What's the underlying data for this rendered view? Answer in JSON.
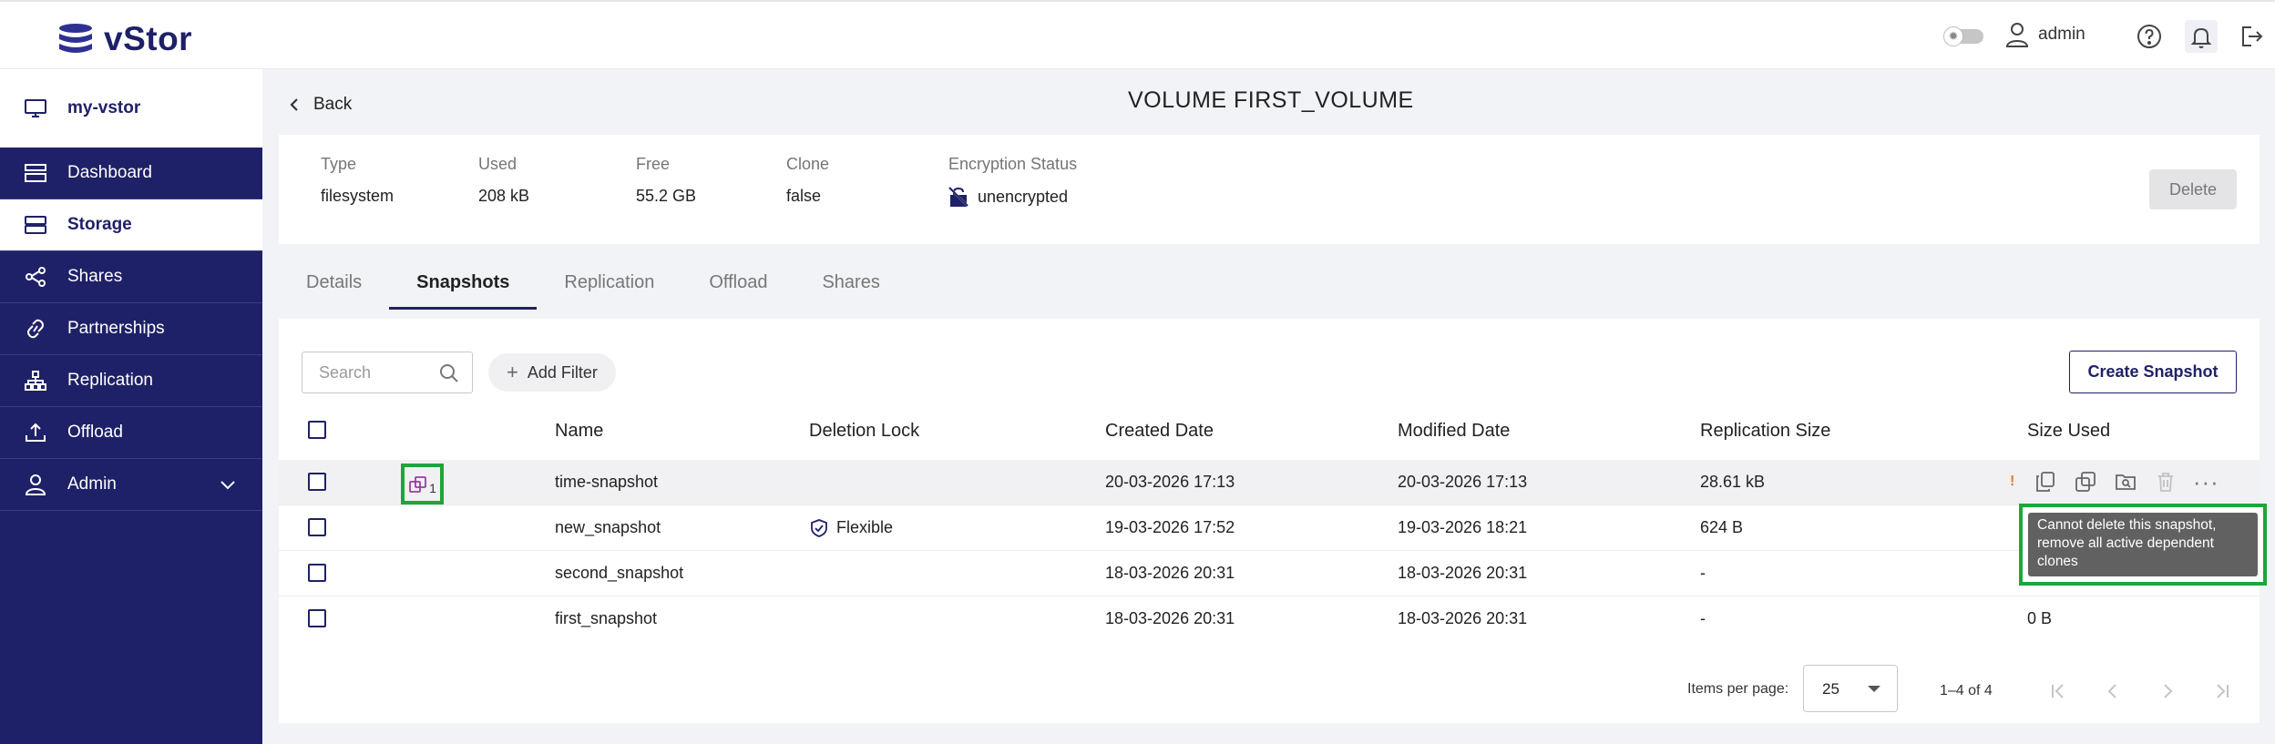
{
  "app": {
    "name": "vStor"
  },
  "header": {
    "user_label": "admin"
  },
  "sidebar": {
    "system_name": "my-vstor",
    "items": [
      {
        "label": "Dashboard"
      },
      {
        "label": "Storage"
      },
      {
        "label": "Shares"
      },
      {
        "label": "Partnerships"
      },
      {
        "label": "Replication"
      },
      {
        "label": "Offload"
      },
      {
        "label": "Admin"
      }
    ]
  },
  "page": {
    "back_label": "Back",
    "title": "VOLUME FIRST_VOLUME"
  },
  "info": {
    "type": {
      "label": "Type",
      "value": "filesystem"
    },
    "used": {
      "label": "Used",
      "value": "208 kB"
    },
    "free": {
      "label": "Free",
      "value": "55.2 GB"
    },
    "clone": {
      "label": "Clone",
      "value": "false"
    },
    "encryption": {
      "label": "Encryption Status",
      "value": "unencrypted"
    },
    "delete_label": "Delete"
  },
  "tabs": [
    {
      "label": "Details"
    },
    {
      "label": "Snapshots"
    },
    {
      "label": "Replication"
    },
    {
      "label": "Offload"
    },
    {
      "label": "Shares"
    }
  ],
  "toolbar": {
    "search_placeholder": "Search",
    "add_filter_label": "Add Filter",
    "create_label": "Create Snapshot"
  },
  "table": {
    "columns": [
      "Name",
      "Deletion Lock",
      "Created Date",
      "Modified Date",
      "Replication Size",
      "Size Used"
    ],
    "rows": [
      {
        "name": "time-snapshot",
        "lock": "",
        "created": "20-03-2026 17:13",
        "modified": "20-03-2026 17:13",
        "repl_size": "28.61 kB",
        "size_used": "",
        "clone_count": "1",
        "warning": "!"
      },
      {
        "name": "new_snapshot",
        "lock": "Flexible",
        "created": "19-03-2026 17:52",
        "modified": "19-03-2026 18:21",
        "repl_size": "624 B",
        "size_used": ""
      },
      {
        "name": "second_snapshot",
        "lock": "",
        "created": "18-03-2026 20:31",
        "modified": "18-03-2026 20:31",
        "repl_size": "-",
        "size_used": ""
      },
      {
        "name": "first_snapshot",
        "lock": "",
        "created": "18-03-2026 20:31",
        "modified": "18-03-2026 20:31",
        "repl_size": "-",
        "size_used": "0 B"
      }
    ]
  },
  "tooltip": {
    "text": "Cannot delete this snapshot, remove all active dependent clones"
  },
  "pagination": {
    "items_per_page_label": "Items per page:",
    "items_per_page": "25",
    "range": "1–4 of 4"
  },
  "colors": {
    "brand": "#1f2168",
    "highlight": "#1fa53a",
    "warning": "#e07a1f"
  }
}
